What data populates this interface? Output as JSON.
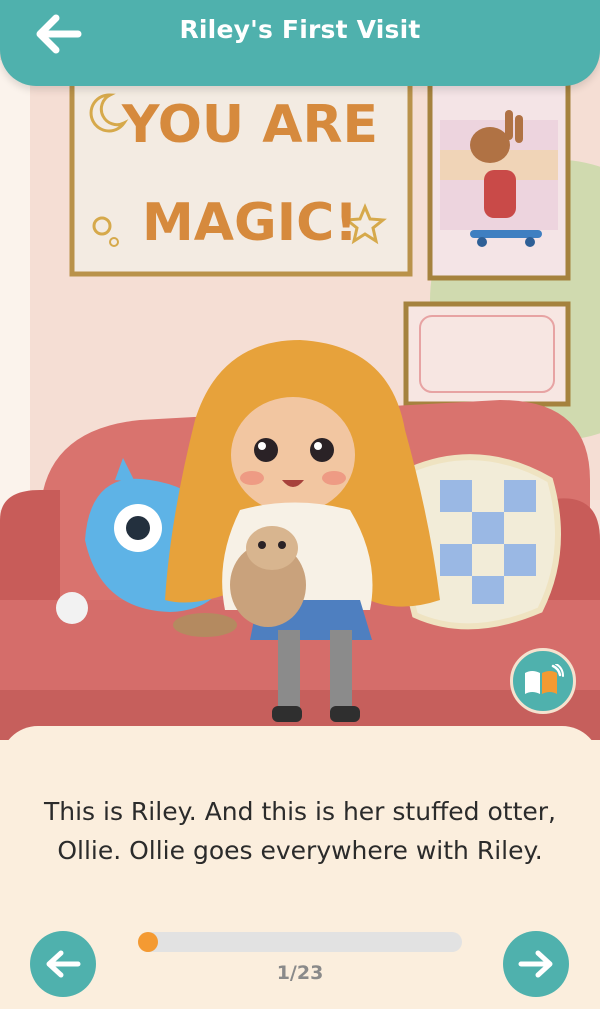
{
  "header": {
    "title": "Riley's First Visit",
    "back_icon": "arrow-left-icon",
    "color": "#4fb1ad"
  },
  "illustration": {
    "poster_text_line1": "YOU ARE",
    "poster_text_line2": "MAGIC!"
  },
  "audio_button": {
    "icon": "book-audio-icon"
  },
  "story": {
    "text": "This is Riley. And this is her stuffed otter, Ollie. Ollie goes everywhere with Riley."
  },
  "navigation": {
    "prev_icon": "arrow-left-icon",
    "next_icon": "arrow-right-icon",
    "current_page": 1,
    "total_pages": 23,
    "page_label": "1/23",
    "progress_color": "#f49a32"
  }
}
